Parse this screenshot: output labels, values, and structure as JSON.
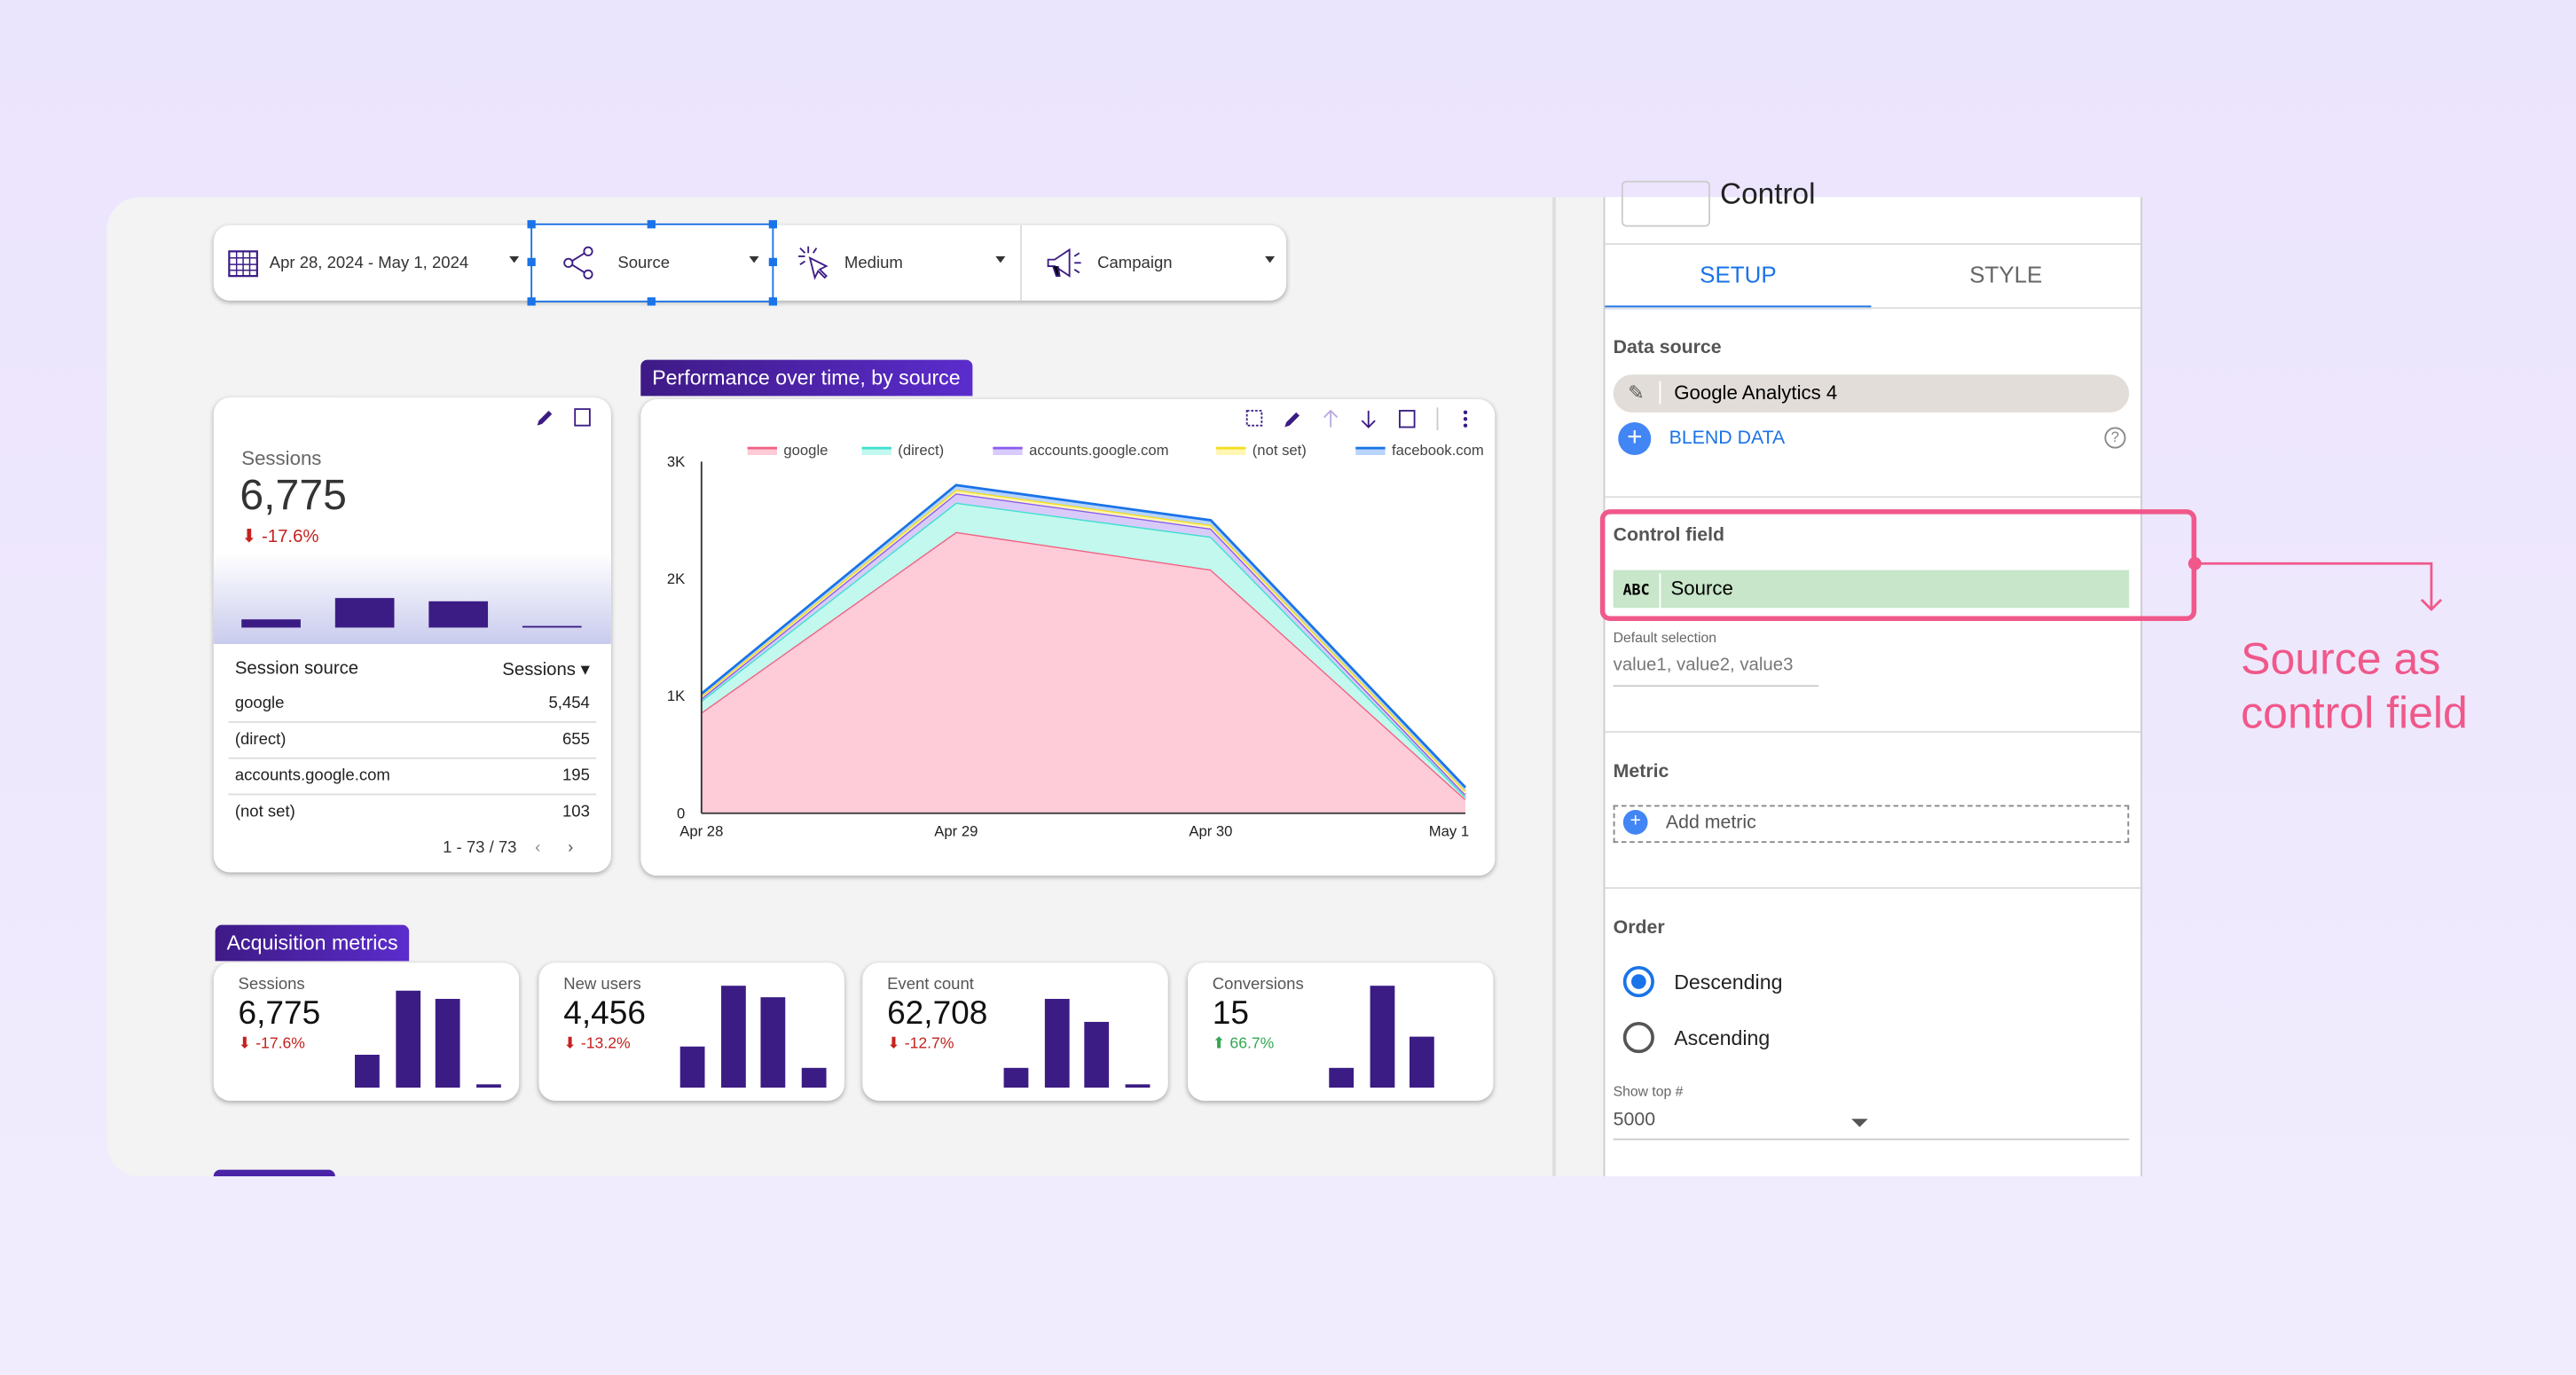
{
  "filters": [
    {
      "label": "Apr 28, 2024 - May 1, 2024",
      "icon": "calendar-icon"
    },
    {
      "label": "Source",
      "icon": "share-icon"
    },
    {
      "label": "Medium",
      "icon": "click-icon"
    },
    {
      "label": "Campaign",
      "icon": "megaphone-icon"
    }
  ],
  "sessions_card": {
    "label": "Sessions",
    "value": "6,775",
    "change": "-17.6%",
    "sparkline": [
      0.25,
      0.8,
      0.75,
      0.03
    ],
    "table": {
      "headers": [
        "Session source",
        "Sessions"
      ],
      "rows": [
        [
          "google",
          "5,454"
        ],
        [
          "(direct)",
          "655"
        ],
        [
          "accounts.google.com",
          "195"
        ],
        [
          "(not set)",
          "103"
        ]
      ],
      "pagination": "1 - 73 / 73"
    }
  },
  "chart_title": "Performance over time, by source",
  "chart_data": {
    "type": "area",
    "stacked": true,
    "x": [
      "Apr 28",
      "Apr 29",
      "Apr 30",
      "May 1"
    ],
    "yticks": [
      "0",
      "1K",
      "2K",
      "3K"
    ],
    "ylim": [
      0,
      3000
    ],
    "legend_position": "top",
    "series": [
      {
        "name": "google",
        "color": "#f06283",
        "fill": "#fecbd8",
        "values": [
          860,
          2400,
          2080,
          120
        ]
      },
      {
        "name": "(direct)",
        "color": "#3fe0cf",
        "fill": "#c2f8ee",
        "values": [
          100,
          250,
          280,
          20
        ]
      },
      {
        "name": "accounts.google.com",
        "color": "#8a5cf0",
        "fill": "#d8cbfa",
        "values": [
          20,
          80,
          70,
          20
        ]
      },
      {
        "name": "(not set)",
        "color": "#f5dc1c",
        "fill": "#fdf6b4",
        "values": [
          20,
          30,
          30,
          30
        ]
      },
      {
        "name": "facebook.com",
        "color": "#1a73e8",
        "fill": "#b9d5fb",
        "values": [
          20,
          40,
          40,
          30
        ]
      }
    ]
  },
  "acquisition_title": "Acquisition metrics",
  "scorecards": [
    {
      "label": "Sessions",
      "value": "6,775",
      "change": "-17.6%",
      "trend": "down",
      "bars": [
        0.33,
        0.95,
        0.87,
        0.04
      ]
    },
    {
      "label": "New users",
      "value": "4,456",
      "change": "-13.2%",
      "trend": "down",
      "bars": [
        0.4,
        1,
        0.88,
        0.2
      ]
    },
    {
      "label": "Event count",
      "value": "62,708",
      "change": "-12.7%",
      "trend": "down",
      "bars": [
        0.2,
        0.87,
        0.65,
        0.03
      ]
    },
    {
      "label": "Conversions",
      "value": "15",
      "change": "66.7%",
      "trend": "up",
      "bars": [
        0.2,
        1,
        0.5,
        0
      ]
    }
  ],
  "panel": {
    "title": "Control",
    "tabs": [
      "SETUP",
      "STYLE"
    ],
    "active_tab": "SETUP",
    "data_source_label": "Data source",
    "data_source": "Google Analytics 4",
    "blend": "BLEND DATA",
    "control_field_label": "Control field",
    "field_type": "ABC",
    "control_field": "Source",
    "default_selection_label": "Default selection",
    "default_selection_placeholder": "value1, value2, value3",
    "metric_label": "Metric",
    "add_metric": "Add metric",
    "order_label": "Order",
    "orders": [
      "Descending",
      "Ascending"
    ],
    "order_selected": "Descending",
    "show_top_label": "Show top #",
    "show_top": "5000"
  },
  "annotation": {
    "text": "Source as control field",
    "color": "#f0588a"
  },
  "colors": {
    "accent": "#1a73e8",
    "brand": "#3b1c84",
    "negative": "#c5221f",
    "positive": "#34a853"
  }
}
